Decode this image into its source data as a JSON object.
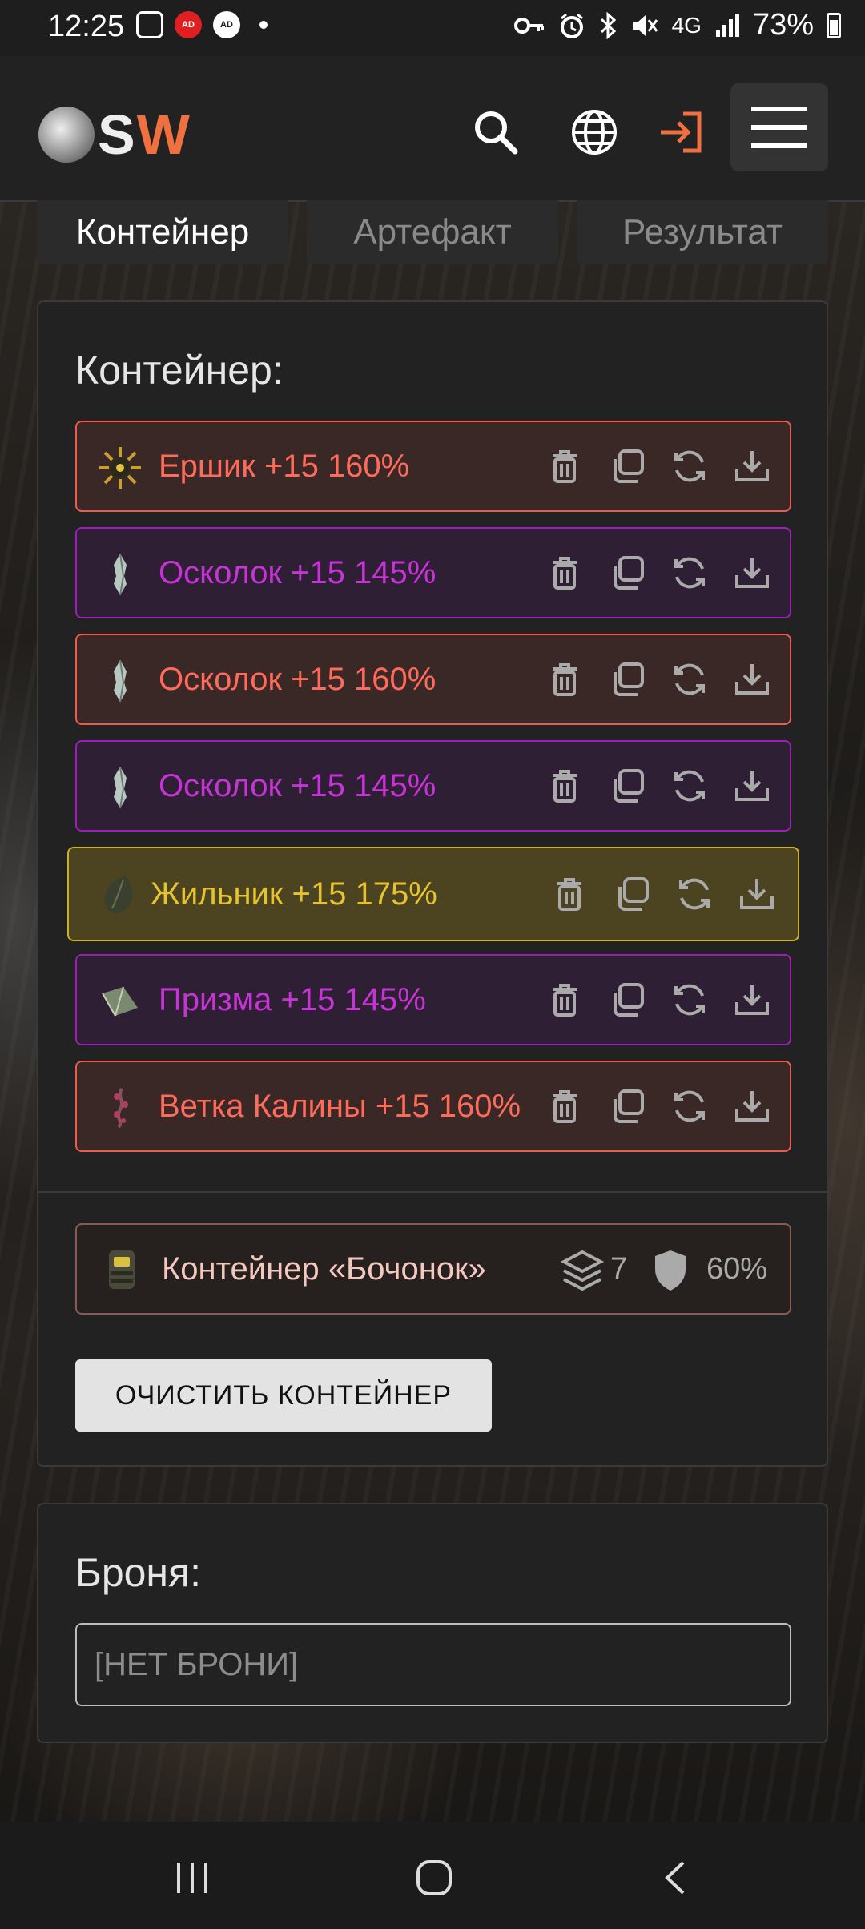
{
  "status_bar": {
    "time": "12:25",
    "network": "4G",
    "battery": "73%",
    "icons": [
      "image-icon",
      "ad-blocker-icon",
      "ad-blocker-icon",
      "dot-icon",
      "key-icon",
      "alarm-icon",
      "bluetooth-icon",
      "mute-icon",
      "signal-icon",
      "battery-icon"
    ]
  },
  "header": {
    "logo_s": "S",
    "logo_w": "W",
    "icons": [
      "search-icon",
      "globe-icon",
      "login-icon",
      "hamburger-menu-icon"
    ],
    "colors": {
      "logo_w": "#f07040",
      "login": "#f07040"
    }
  },
  "tabs": [
    {
      "label": "Контейнер",
      "active": true
    },
    {
      "label": "Артефакт",
      "active": false
    },
    {
      "label": "Результат",
      "active": false
    }
  ],
  "container_panel": {
    "title": "Контейнер:",
    "items": [
      {
        "label": "Ершик +15 160%",
        "rarity": "red",
        "icon": "ershik-artifact-icon"
      },
      {
        "label": "Осколок +15 145%",
        "rarity": "purple",
        "icon": "shard-artifact-icon"
      },
      {
        "label": "Осколок +15 160%",
        "rarity": "red",
        "icon": "shard-artifact-icon"
      },
      {
        "label": "Осколок +15 145%",
        "rarity": "purple",
        "icon": "shard-artifact-icon"
      },
      {
        "label": "Жильник +15 175%",
        "rarity": "gold",
        "icon": "zhilnik-artifact-icon"
      },
      {
        "label": "Призма +15 145%",
        "rarity": "purple",
        "icon": "prism-artifact-icon"
      },
      {
        "label": "Ветка Калины +15 160%",
        "rarity": "red",
        "icon": "viburnum-branch-artifact-icon"
      }
    ],
    "item_actions": [
      "trash-icon",
      "copy-icon",
      "refresh-icon",
      "download-icon"
    ],
    "container": {
      "name": "Контейнер «Бочонок»",
      "slots": "7",
      "protection": "60%"
    },
    "clear_button": "ОЧИСТИТЬ КОНТЕЙНЕР",
    "colors": {
      "red": "#ef5a4e",
      "purple": "#9b1fb8",
      "gold": "#cbb02a"
    }
  },
  "armor_panel": {
    "title": "Броня:",
    "value": "[НЕТ БРОНИ]"
  },
  "nav_bar": {
    "icons": [
      "recent-apps-icon",
      "home-icon",
      "back-icon"
    ]
  }
}
